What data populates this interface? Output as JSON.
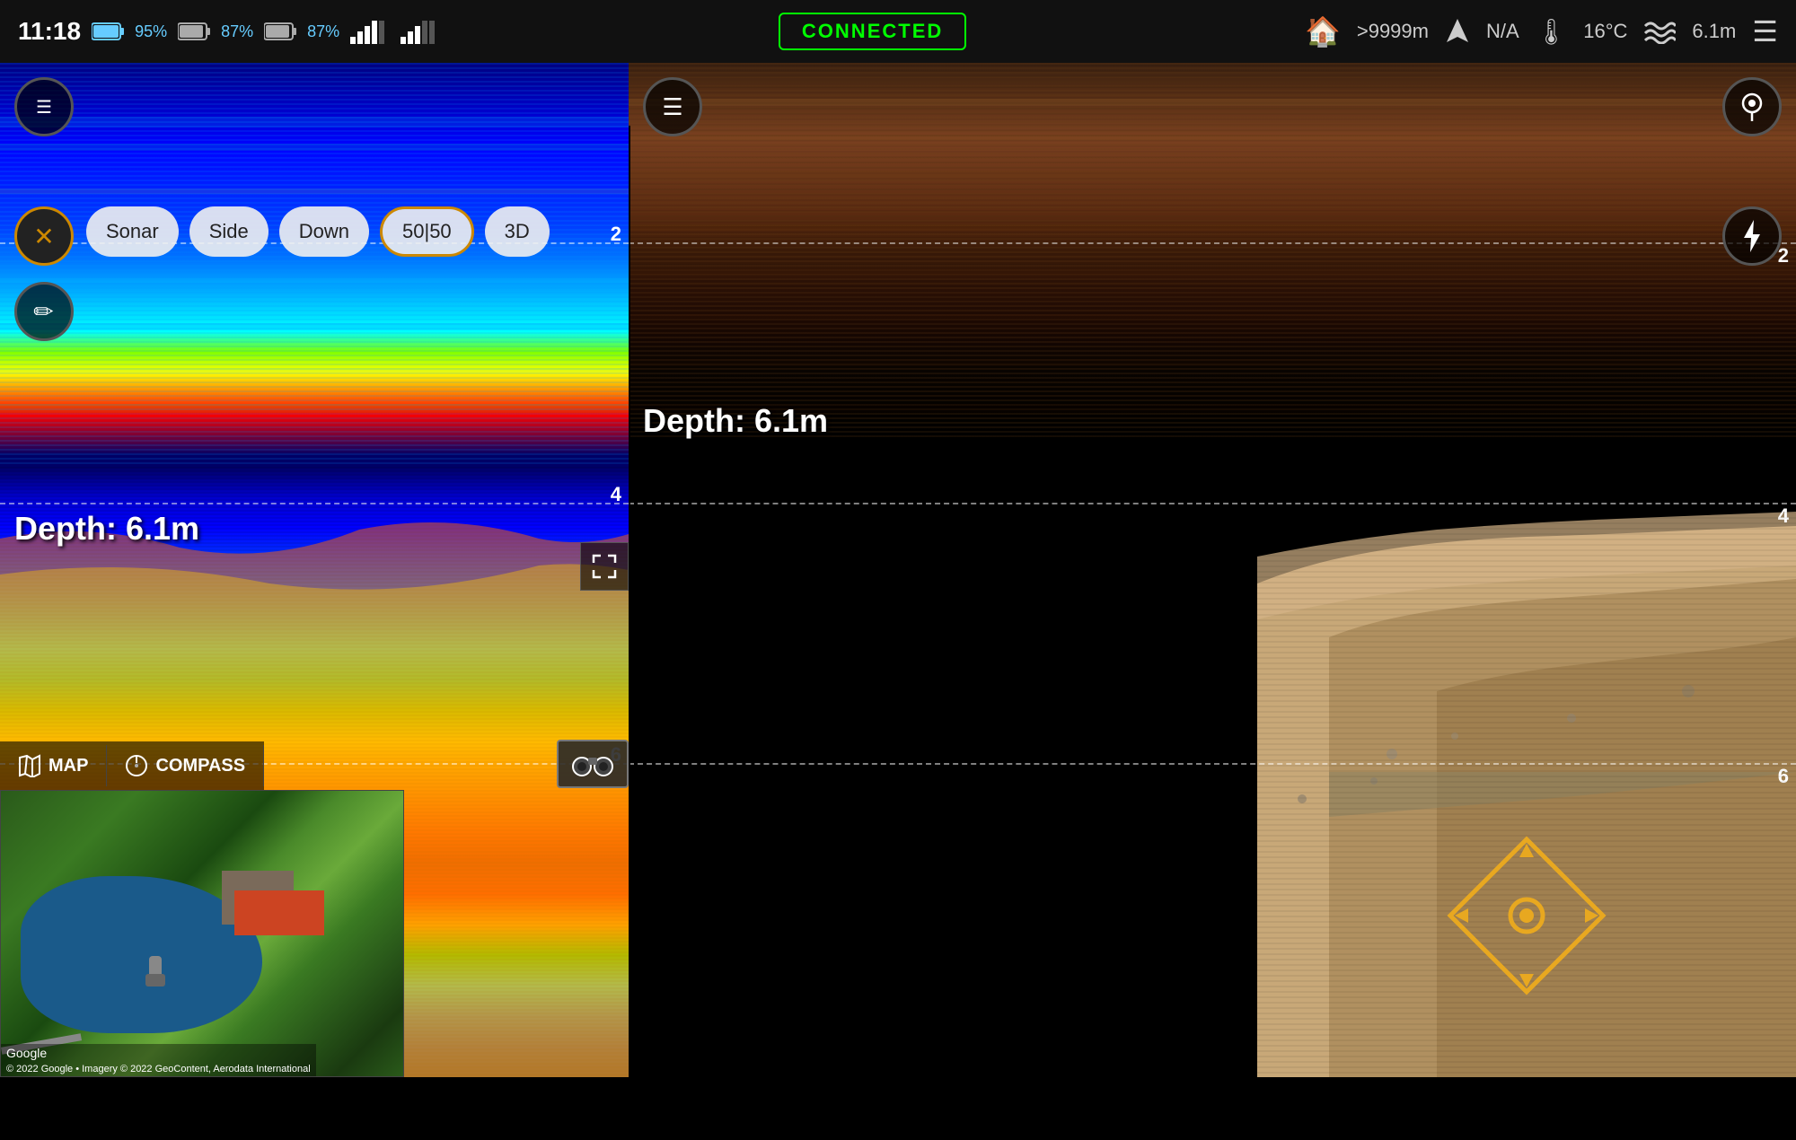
{
  "statusBar": {
    "time": "11:18",
    "battery1": "95%",
    "battery2": "87%",
    "battery3": "87%",
    "connected": "CONNECTED",
    "distance": ">9999m",
    "direction": "N/A",
    "temperature": "16°C",
    "depth_status": "6.1m"
  },
  "leftPanel": {
    "buttons": {
      "menu": "☰",
      "close": "✕",
      "pencil": "✎"
    },
    "modeTabs": [
      "Sonar",
      "Side",
      "Down",
      "50|50",
      "3D"
    ],
    "activeTab": "50|50",
    "depthLabel": "Depth:",
    "depthValue": "6.1m",
    "depthLine2": "2",
    "depthLine4": "4",
    "depthLine6": "6"
  },
  "mapOverlay": {
    "mapLabel": "MAP",
    "compassLabel": "COMPASS",
    "binoIcon": "👁",
    "expandIcon": "⤢",
    "googleText": "Google",
    "attribution": "© 2022 Google • Imagery © 2022 GeoContent, Aerodata International"
  },
  "rightPanel": {
    "menuIcon": "☰",
    "waypointIcon": "📍",
    "flashIcon": "⚡",
    "depthLabel": "Depth:",
    "depthValue": "6.1m",
    "depthLine2": "2",
    "depthLine4": "4",
    "depthLine6": "6"
  },
  "icons": {
    "home": "🏠",
    "navigation": "➤",
    "thermometer": "🌡",
    "waves": "〰",
    "menu": "☰",
    "map_marker": "◉",
    "compass_marker": "◎"
  }
}
